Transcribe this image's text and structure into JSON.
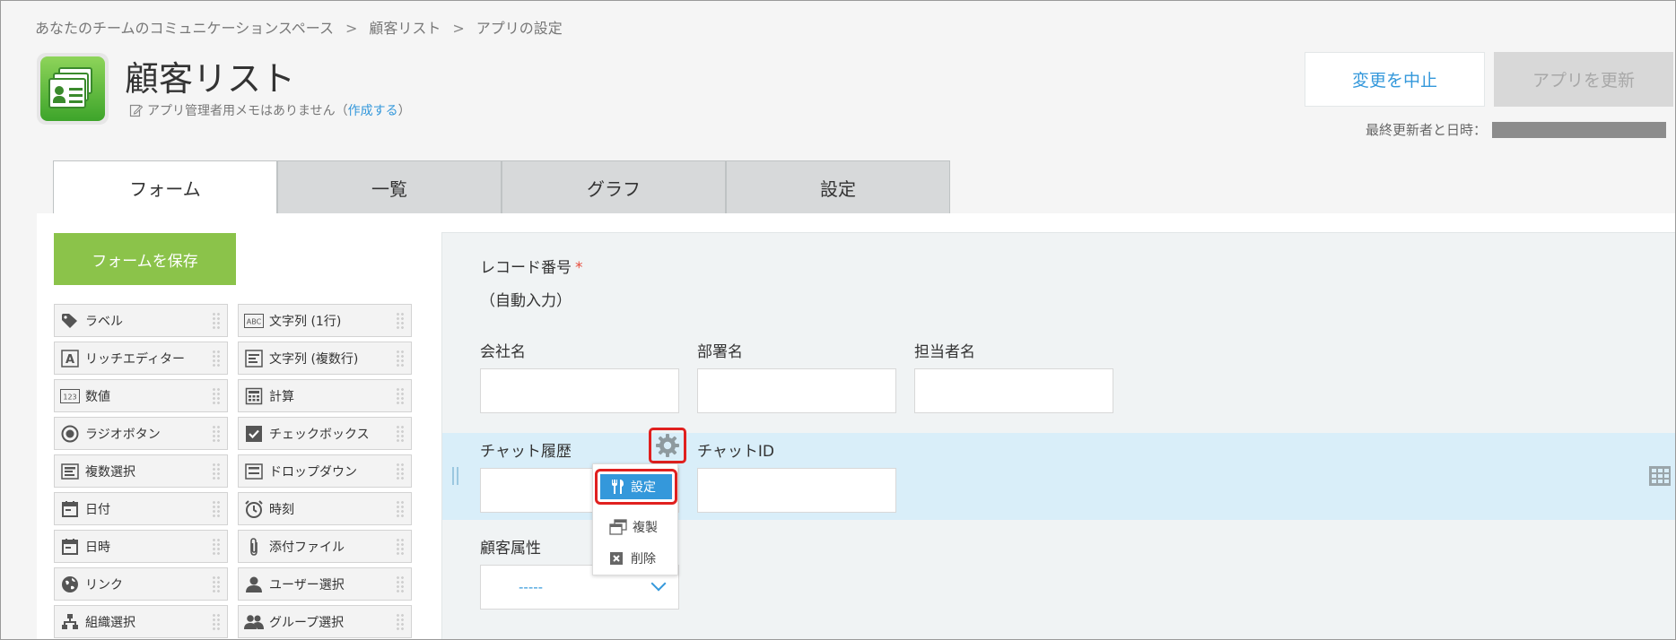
{
  "breadcrumb": {
    "space": "あなたのチームのコミュニケーションスペース",
    "app": "顧客リスト",
    "current": "アプリの設定",
    "separator": ">"
  },
  "app": {
    "title": "顧客リスト",
    "memo_text": "アプリ管理者用メモはありません（",
    "memo_link": "作成する",
    "memo_close": "）"
  },
  "header_buttons": {
    "cancel": "変更を中止",
    "update": "アプリを更新"
  },
  "last_updated_label": "最終更新者と日時：",
  "tabs": [
    {
      "label": "フォーム",
      "active": true
    },
    {
      "label": "一覧",
      "active": false
    },
    {
      "label": "グラフ",
      "active": false
    },
    {
      "label": "設定",
      "active": false
    }
  ],
  "save_form": "フォームを保存",
  "palette": [
    {
      "label": "ラベル",
      "icon": "tag-icon"
    },
    {
      "label": "文字列 (1行)",
      "icon": "abc-icon"
    },
    {
      "label": "リッチエディター",
      "icon": "rich-text-icon"
    },
    {
      "label": "文字列 (複数行)",
      "icon": "multiline-text-icon"
    },
    {
      "label": "数値",
      "icon": "number-icon"
    },
    {
      "label": "計算",
      "icon": "calculator-icon"
    },
    {
      "label": "ラジオボタン",
      "icon": "radio-icon"
    },
    {
      "label": "チェックボックス",
      "icon": "checkbox-icon"
    },
    {
      "label": "複数選択",
      "icon": "multi-select-icon"
    },
    {
      "label": "ドロップダウン",
      "icon": "dropdown-icon"
    },
    {
      "label": "日付",
      "icon": "calendar-icon"
    },
    {
      "label": "時刻",
      "icon": "clock-icon"
    },
    {
      "label": "日時",
      "icon": "datetime-icon"
    },
    {
      "label": "添付ファイル",
      "icon": "paperclip-icon"
    },
    {
      "label": "リンク",
      "icon": "globe-icon"
    },
    {
      "label": "ユーザー選択",
      "icon": "user-icon"
    },
    {
      "label": "組織選択",
      "icon": "org-icon"
    },
    {
      "label": "グループ選択",
      "icon": "group-icon"
    }
  ],
  "form": {
    "record_number_label": "レコード番号",
    "required_mark": "*",
    "record_number_value": "（自動入力）",
    "company_label": "会社名",
    "department_label": "部署名",
    "person_label": "担当者名",
    "chat_history_label": "チャット履歴",
    "chat_id_label": "チャットID",
    "customer_attr_label": "顧客属性",
    "customer_attr_value": "-----"
  },
  "context_menu": {
    "settings": "設定",
    "duplicate": "複製",
    "delete": "削除"
  },
  "colors": {
    "accent": "#3498db",
    "save_green": "#8bc34a",
    "highlight_red": "#e0201f",
    "row_highlight": "#d9eef9"
  }
}
